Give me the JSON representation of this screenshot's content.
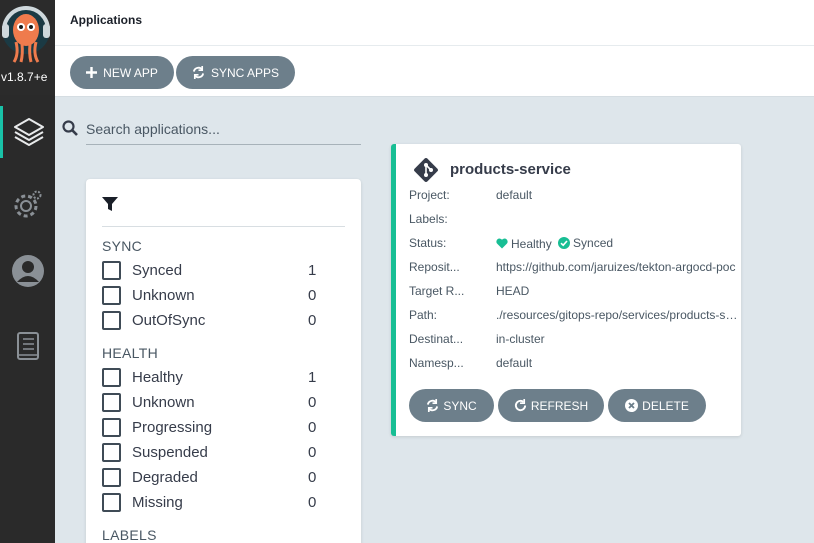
{
  "sidebar": {
    "version": "v1.8.7+e",
    "items": [
      {
        "name": "applications",
        "icon": "layers-icon",
        "active": true
      },
      {
        "name": "settings",
        "icon": "gear-icon",
        "active": false
      },
      {
        "name": "user-info",
        "icon": "user-icon",
        "active": false
      },
      {
        "name": "documentation",
        "icon": "book-icon",
        "active": false
      }
    ]
  },
  "header": {
    "title": "Applications"
  },
  "toolbar": {
    "new_app_label": "NEW APP",
    "sync_apps_label": "SYNC APPS"
  },
  "search": {
    "placeholder": "Search applications..."
  },
  "filters": {
    "sync_title": "SYNC",
    "sync": [
      {
        "label": "Synced",
        "count": "1"
      },
      {
        "label": "Unknown",
        "count": "0"
      },
      {
        "label": "OutOfSync",
        "count": "0"
      }
    ],
    "health_title": "HEALTH",
    "health": [
      {
        "label": "Healthy",
        "count": "1"
      },
      {
        "label": "Unknown",
        "count": "0"
      },
      {
        "label": "Progressing",
        "count": "0"
      },
      {
        "label": "Suspended",
        "count": "0"
      },
      {
        "label": "Degraded",
        "count": "0"
      },
      {
        "label": "Missing",
        "count": "0"
      }
    ],
    "labels_title": "LABELS"
  },
  "app": {
    "name": "products-service",
    "fields": {
      "project_label": "Project:",
      "project": "default",
      "labels_label": "Labels:",
      "labels": "",
      "status_label": "Status:",
      "health": "Healthy",
      "sync": "Synced",
      "repo_label": "Reposit...",
      "repo": "https://github.com/jaruizes/tekton-argocd-poc",
      "target_label": "Target R...",
      "target": "HEAD",
      "path_label": "Path:",
      "path": "./resources/gitops-repo/services/products-service",
      "dest_label": "Destinat...",
      "dest": "in-cluster",
      "ns_label": "Namesp...",
      "ns": "default"
    },
    "actions": {
      "sync": "SYNC",
      "refresh": "REFRESH",
      "delete": "DELETE"
    }
  },
  "colors": {
    "accent": "#19c2a8",
    "healthy": "#18be94",
    "button": "#6d7f8b"
  }
}
